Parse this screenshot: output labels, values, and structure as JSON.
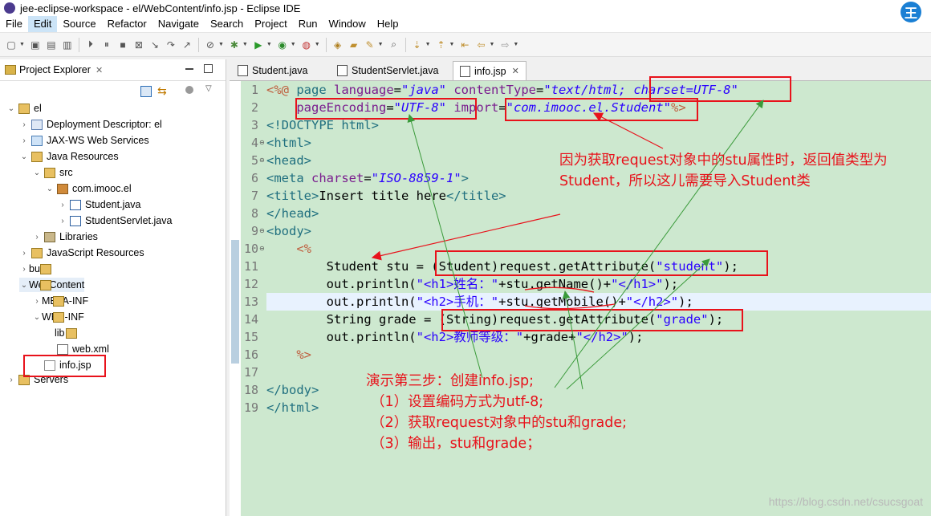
{
  "window": {
    "title": "jee-eclipse-workspace - el/WebContent/info.jsp - Eclipse IDE",
    "avatar_char": "王"
  },
  "menu": [
    "File",
    "Edit",
    "Source",
    "Refactor",
    "Navigate",
    "Search",
    "Project",
    "Run",
    "Window",
    "Help"
  ],
  "explorer": {
    "title": "Project Explorer",
    "close": "✕",
    "tree": [
      {
        "label": "el",
        "depth": 0,
        "icon": "project-icon",
        "expanded": true
      },
      {
        "label": "Deployment Descriptor: el",
        "depth": 1,
        "icon": "deployment-descriptor-icon",
        "expanded": false
      },
      {
        "label": "JAX-WS Web Services",
        "depth": 1,
        "icon": "web-services-icon",
        "expanded": false
      },
      {
        "label": "Java Resources",
        "depth": 1,
        "icon": "java-resources-icon",
        "expanded": true
      },
      {
        "label": "src",
        "depth": 2,
        "icon": "source-folder-icon",
        "expanded": true
      },
      {
        "label": "com.imooc.el",
        "depth": 3,
        "icon": "package-icon",
        "expanded": true
      },
      {
        "label": "Student.java",
        "depth": 4,
        "icon": "java-file-icon",
        "expanded": false
      },
      {
        "label": "StudentServlet.java",
        "depth": 4,
        "icon": "java-file-icon",
        "expanded": false
      },
      {
        "label": "Libraries",
        "depth": 2,
        "icon": "libraries-icon",
        "expanded": false
      },
      {
        "label": "JavaScript Resources",
        "depth": 1,
        "icon": "javascript-resources-icon",
        "expanded": false
      },
      {
        "label": "build",
        "depth": 1,
        "icon": "folder-icon",
        "expanded": false
      },
      {
        "label": "WebContent",
        "depth": 1,
        "icon": "folder-icon",
        "expanded": true
      },
      {
        "label": "META-INF",
        "depth": 2,
        "icon": "folder-icon",
        "expanded": false
      },
      {
        "label": "WEB-INF",
        "depth": 2,
        "icon": "folder-icon",
        "expanded": true
      },
      {
        "label": "lib",
        "depth": 3,
        "icon": "folder-icon",
        "expanded": null
      },
      {
        "label": "web.xml",
        "depth": 3,
        "icon": "xml-file-icon",
        "expanded": null
      },
      {
        "label": "info.jsp",
        "depth": 2,
        "icon": "jsp-file-icon",
        "expanded": null
      },
      {
        "label": "Servers",
        "depth": 0,
        "icon": "servers-icon",
        "expanded": false
      }
    ]
  },
  "tabs": [
    {
      "label": "Student.java",
      "active": false,
      "closable": false
    },
    {
      "label": "StudentServlet.java",
      "active": false,
      "closable": false
    },
    {
      "label": "info.jsp",
      "active": true,
      "closable": true,
      "close": "✕"
    }
  ],
  "line_numbers": [
    "1",
    "2",
    "3",
    "4",
    "5",
    "6",
    "7",
    "8",
    "9",
    "10",
    "11",
    "12",
    "13",
    "14",
    "15",
    "16",
    "17",
    "18",
    "19"
  ],
  "code": {
    "l1": {
      "a": "<%@ ",
      "b": "page",
      "c": " ",
      "d": "language",
      "e": "=",
      "f": "\"java\"",
      "g": " ",
      "h": "contentType",
      "i": "=",
      "j": "\"text/html; charset=UTF-8\""
    },
    "l2": {
      "pad": "    ",
      "a": "pageEncoding",
      "b": "=",
      "c": "\"UTF-8\"",
      "d": " ",
      "e": "import",
      "f": "=",
      "g": "\"com.imooc.el.Student\"",
      "h": "%>"
    },
    "l3": {
      "a": "<!DOCTYPE html>"
    },
    "l4": {
      "a": "<html>"
    },
    "l5": {
      "a": "<head>"
    },
    "l6": {
      "a": "<meta ",
      "b": "charset",
      "c": "=",
      "d": "\"ISO-8859-1\"",
      "e": ">"
    },
    "l7": {
      "a": "<title>",
      "b": "Insert title here",
      "c": "</title>"
    },
    "l8": {
      "a": "</head>"
    },
    "l9": {
      "a": "<body>"
    },
    "l10": {
      "pad": "    ",
      "a": "<%"
    },
    "l11": {
      "a": "        Student stu = (Student)request.getAttribute(",
      "b": "\"student\"",
      "c": ");"
    },
    "l12": {
      "a": "        out.println(",
      "b": "\"<h1>姓名：\"",
      "c": "+stu.getName()+",
      "d": "\"</h1>\"",
      "e": ");"
    },
    "l13": {
      "a": "        out.println(",
      "b": "\"<h2>手机：\"",
      "c": "+stu.getMobile()+",
      "d": "\"</h2>\"",
      "e": ");"
    },
    "l14": {
      "a": "        String grade = (String)request.getAttribute(",
      "b": "\"grade\"",
      "c": ");"
    },
    "l15": {
      "a": "        out.println(",
      "b": "\"<h2>教师等级：\"",
      "c": "+grade+",
      "d": "\"</h2>\"",
      "e": ");"
    },
    "l16": {
      "pad": "    ",
      "a": "%>"
    },
    "l17": {
      "a": ""
    },
    "l18": {
      "a": "</body>"
    },
    "l19": {
      "a": "</html>"
    }
  },
  "annotations": {
    "note1_line1": "因为获取request对象中的stu属性时，返回值类型为",
    "note1_line2": "Student，所以这儿需要导入Student类",
    "steps_title": "演示第三步：创建info.jsp;",
    "step1": "（1）设置编码方式为utf-8;",
    "step2": "（2）获取request对象中的stu和grade;",
    "step3": "（3）输出，stu和grade；"
  },
  "watermark": "https://blog.csdn.net/csucsgoat",
  "colors": {
    "editor_bg": "#cde8cf",
    "highlight_red": "#e8121b",
    "arrow_green": "#3a9a3a",
    "current_line": "#e8f2fe"
  }
}
